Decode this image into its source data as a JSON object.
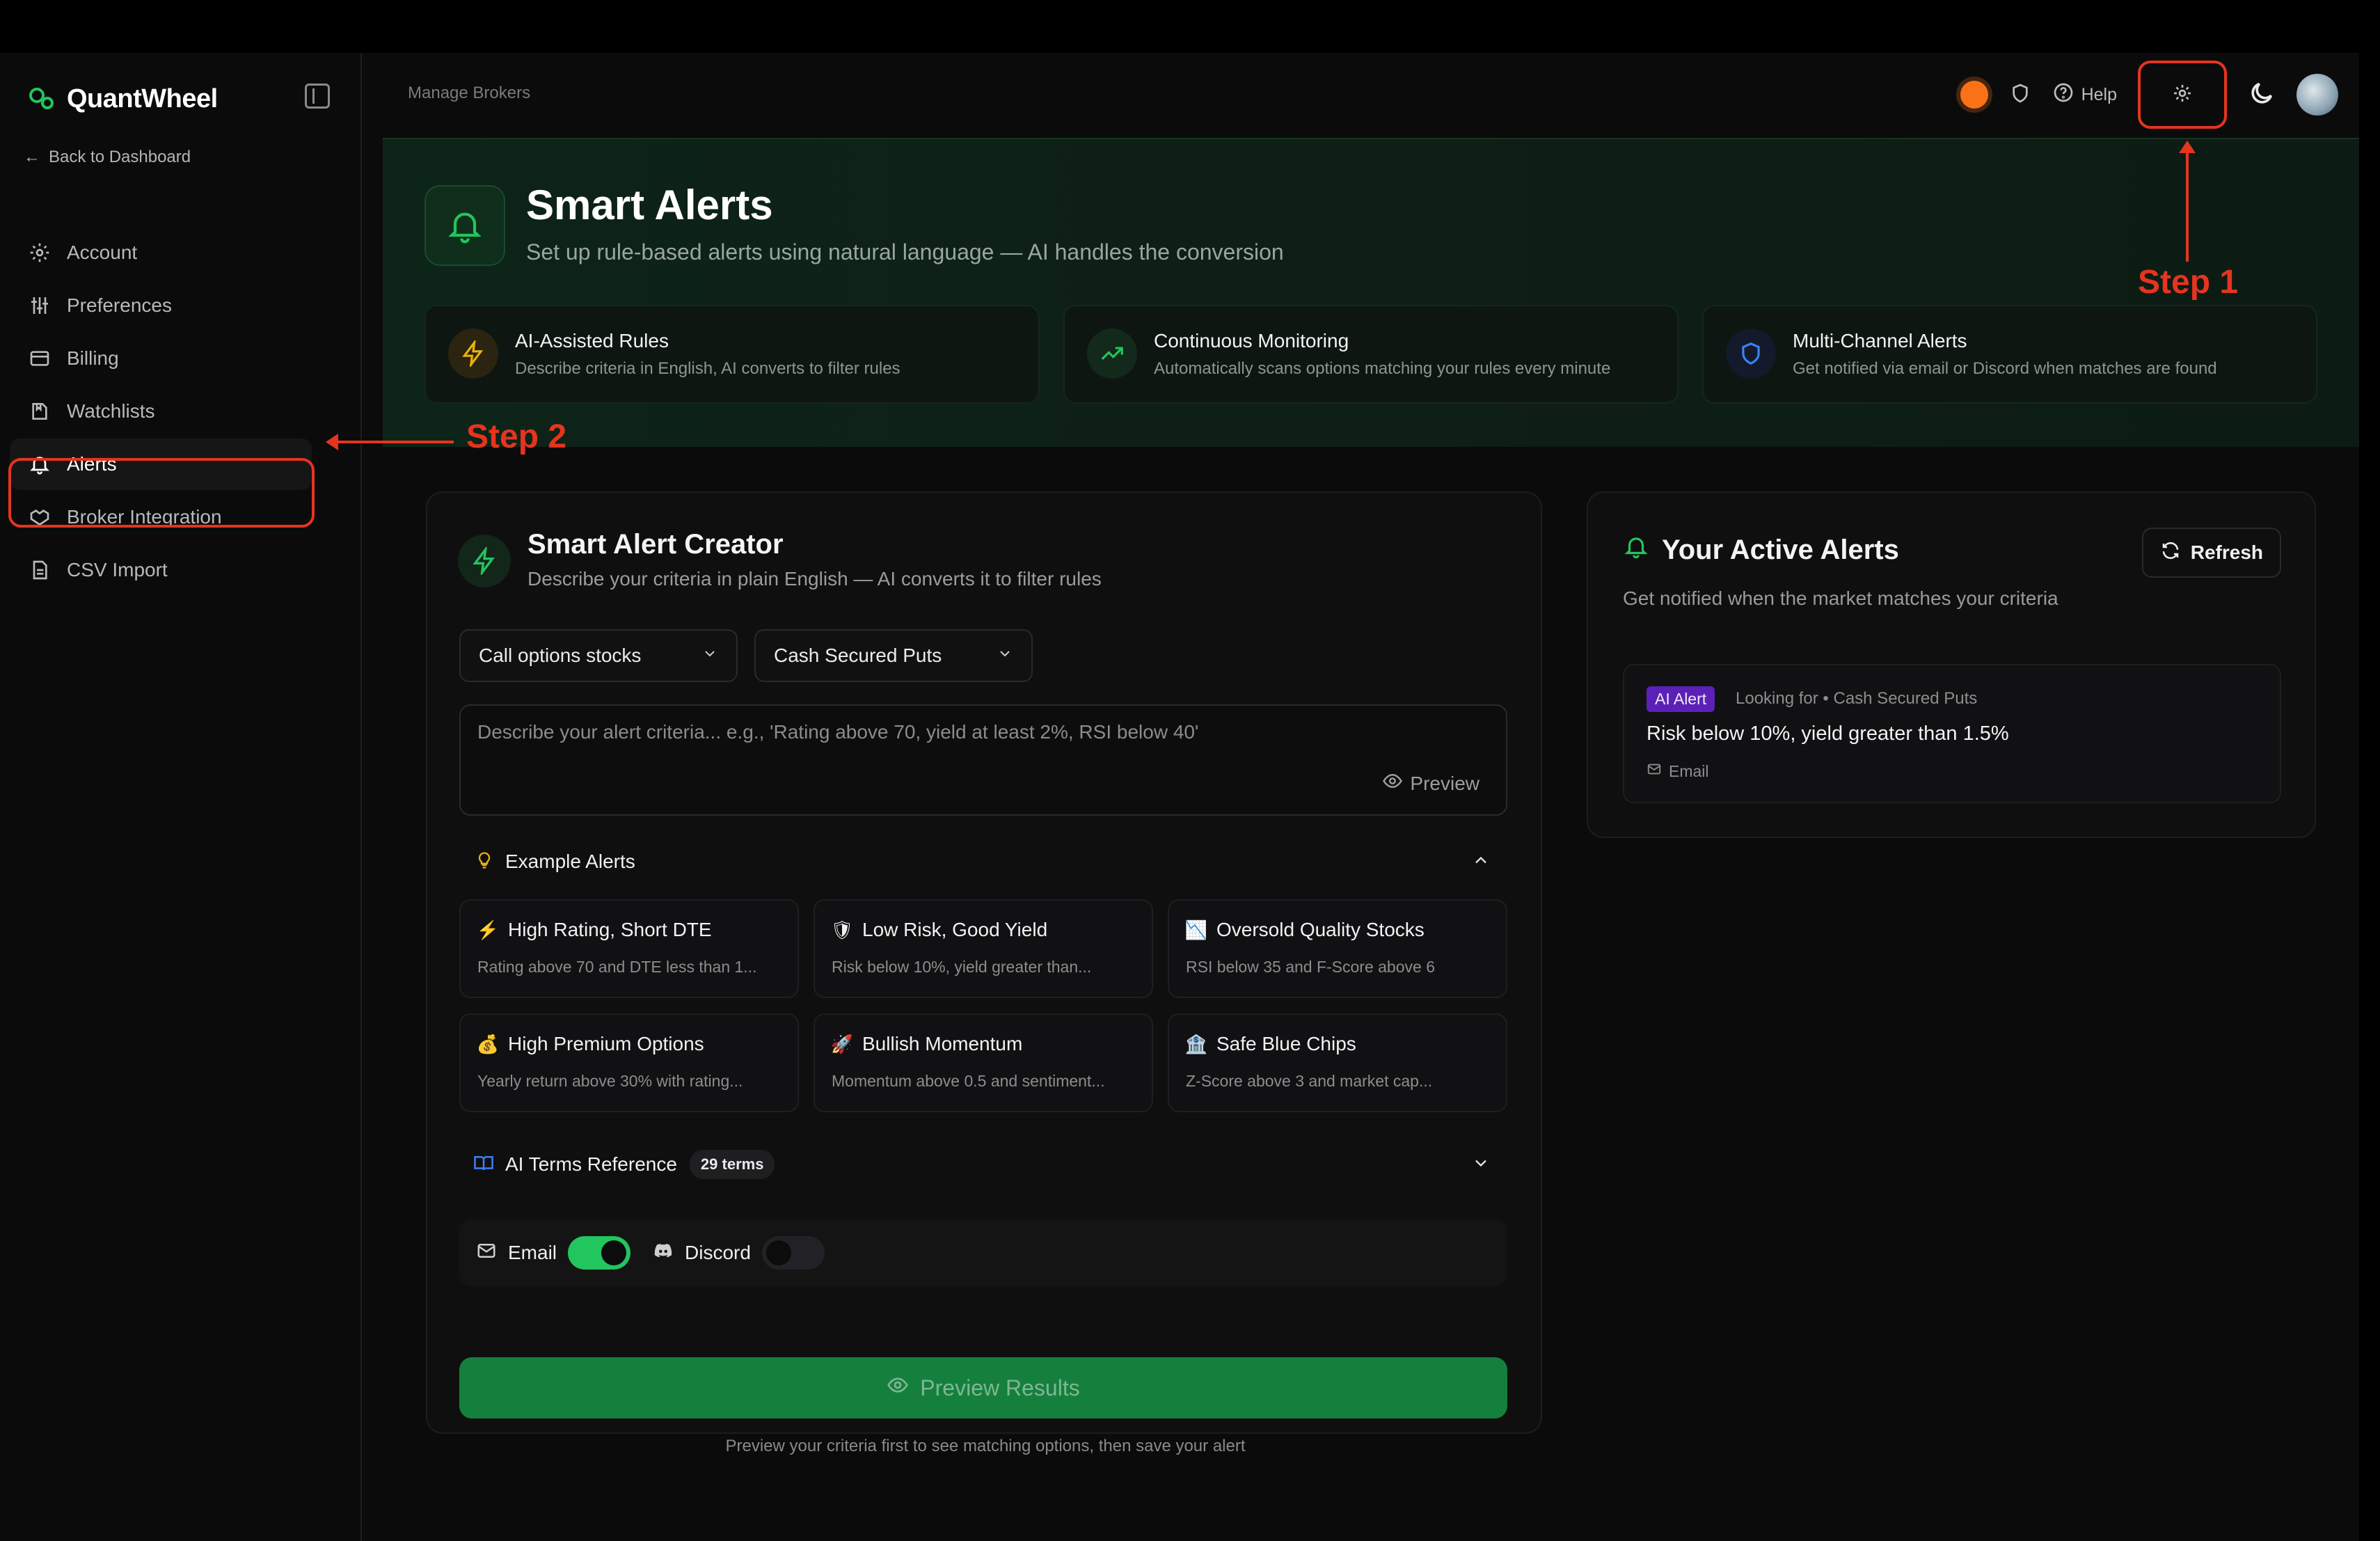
{
  "app": {
    "name": "QuantWheel"
  },
  "sidebar": {
    "back_label": "Back to Dashboard",
    "items": [
      {
        "label": "Account",
        "icon": "gear-icon"
      },
      {
        "label": "Preferences",
        "icon": "sliders-icon"
      },
      {
        "label": "Billing",
        "icon": "credit-card-icon"
      },
      {
        "label": "Watchlists",
        "icon": "bookmark-icon"
      },
      {
        "label": "Alerts",
        "icon": "bell-icon",
        "active": true
      },
      {
        "label": "Broker Integration",
        "icon": "handshake-icon"
      },
      {
        "label": "CSV Import",
        "icon": "file-icon"
      }
    ]
  },
  "topbar": {
    "breadcrumb": "Manage Brokers",
    "help_label": "Help"
  },
  "hero": {
    "title": "Smart Alerts",
    "subtitle": "Set up rule-based alerts using natural language — AI handles the conversion",
    "features": [
      {
        "title": "AI-Assisted Rules",
        "desc": "Describe criteria in English, AI converts to filter rules",
        "icon": "lightning-icon",
        "color": "#eab308"
      },
      {
        "title": "Continuous Monitoring",
        "desc": "Automatically scans options matching your rules every minute",
        "icon": "trending-up-icon",
        "color": "#22c55e"
      },
      {
        "title": "Multi-Channel Alerts",
        "desc": "Get notified via email or Discord when matches are found",
        "icon": "shield-icon",
        "color": "#3b82f6"
      }
    ]
  },
  "creator": {
    "title": "Smart Alert Creator",
    "subtitle": "Describe your criteria in plain English — AI converts it to filter rules",
    "select_1": "Call options stocks",
    "select_2": "Cash Secured Puts",
    "textarea_placeholder": "Describe your alert criteria... e.g., 'Rating above 70, yield at least 2%, RSI below 40'",
    "preview_label": "Preview",
    "examples_label": "Example Alerts",
    "examples": [
      {
        "emoji": "⚡",
        "title": "High Rating, Short DTE",
        "desc": "Rating above 70 and DTE less than 1..."
      },
      {
        "emoji": "🛡",
        "title": "Low Risk, Good Yield",
        "desc": "Risk below 10%, yield greater than..."
      },
      {
        "emoji": "📉",
        "title": "Oversold Quality Stocks",
        "desc": "RSI below 35 and F-Score above 6"
      },
      {
        "emoji": "💰",
        "title": "High Premium Options",
        "desc": "Yearly return above 30% with rating..."
      },
      {
        "emoji": "🚀",
        "title": "Bullish Momentum",
        "desc": "Momentum above 0.5 and sentiment..."
      },
      {
        "emoji": "🏦",
        "title": "Safe Blue Chips",
        "desc": "Z-Score above 3 and market cap..."
      }
    ],
    "terms_label": "AI Terms Reference",
    "terms_count": "29 terms",
    "email_label": "Email",
    "email_on": true,
    "discord_label": "Discord",
    "discord_on": false,
    "preview_results_label": "Preview Results",
    "footnote": "Preview your criteria first to see matching options, then save your alert"
  },
  "active_alerts": {
    "title": "Your Active Alerts",
    "subtitle": "Get notified when the market matches your criteria",
    "refresh_label": "Refresh",
    "items": [
      {
        "badge": "AI Alert",
        "looking": "Looking for • Cash Secured Puts",
        "rule": "Risk below 10%, yield greater than 1.5%",
        "channel": "Email"
      }
    ]
  },
  "annotations": {
    "step1": "Step 1",
    "step2": "Step 2",
    "color": "#e5341f"
  }
}
